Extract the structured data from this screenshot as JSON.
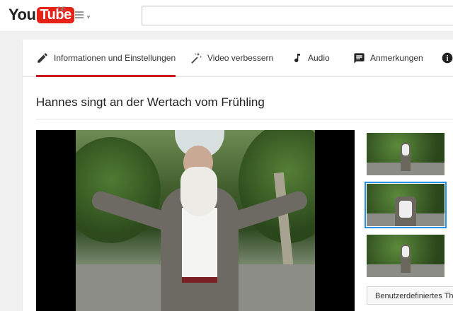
{
  "masthead": {
    "logo_you": "You",
    "logo_tube": "Tube",
    "region": "DE",
    "search_placeholder": ""
  },
  "tabs": [
    {
      "label": "Informationen und Einstellungen",
      "icon": "pencil-icon",
      "active": true
    },
    {
      "label": "Video verbessern",
      "icon": "magic-wand-icon",
      "active": false
    },
    {
      "label": "Audio",
      "icon": "music-note-icon",
      "active": false
    },
    {
      "label": "Anmerkungen",
      "icon": "speech-bubble-icon",
      "active": false
    },
    {
      "label": "",
      "icon": "info-icon",
      "active": false
    }
  ],
  "video": {
    "title": "Hannes singt an der Wertach vom Frühling"
  },
  "thumbnails": {
    "selected_index": 1,
    "custom_button_label": "Benutzerdefiniertes Thum"
  },
  "colors": {
    "accent": "#cc181e",
    "selection": "#2793e6",
    "logo_red": "#e62117"
  }
}
